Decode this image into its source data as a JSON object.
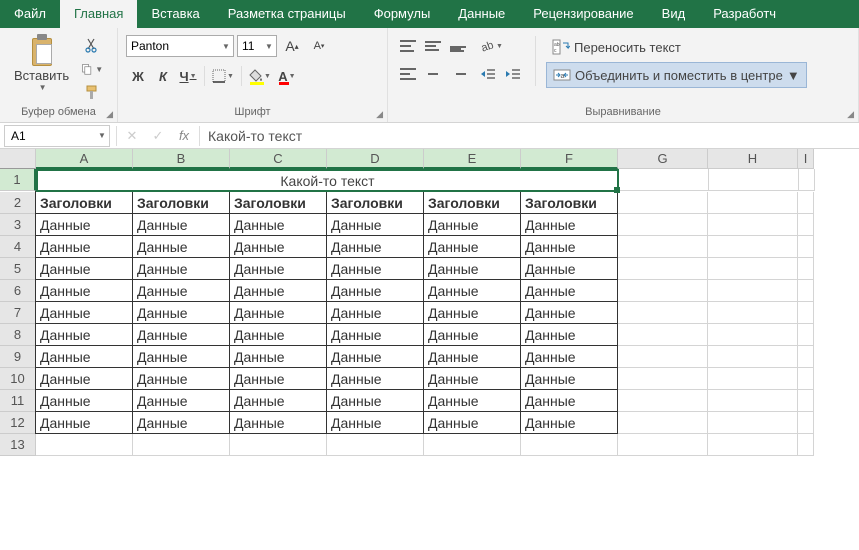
{
  "menu": {
    "tabs": [
      "Файл",
      "Главная",
      "Вставка",
      "Разметка страницы",
      "Формулы",
      "Данные",
      "Рецензирование",
      "Вид",
      "Разработч"
    ],
    "active_index": 1
  },
  "ribbon": {
    "clipboard": {
      "paste_label": "Вставить",
      "group_label": "Буфер обмена"
    },
    "font": {
      "name": "Panton",
      "size": "11",
      "bold": "Ж",
      "italic": "К",
      "underline": "Ч",
      "group_label": "Шрифт"
    },
    "alignment": {
      "wrap_label": "Переносить текст",
      "merge_label": "Объединить и поместить в центре",
      "group_label": "Выравнивание"
    }
  },
  "formula_bar": {
    "cell_ref": "A1",
    "fx": "fx",
    "value": "Какой-то текст"
  },
  "sheet": {
    "columns": [
      "A",
      "B",
      "C",
      "D",
      "E",
      "F",
      "G",
      "H",
      "I"
    ],
    "sel_cols_to": 6,
    "title_cell": "Какой-то текст",
    "headers": [
      "Заголовки",
      "Заголовки",
      "Заголовки",
      "Заголовки",
      "Заголовки",
      "Заголовки"
    ],
    "data_rows": 10,
    "data_value": "Данные",
    "visible_rows": 13
  }
}
